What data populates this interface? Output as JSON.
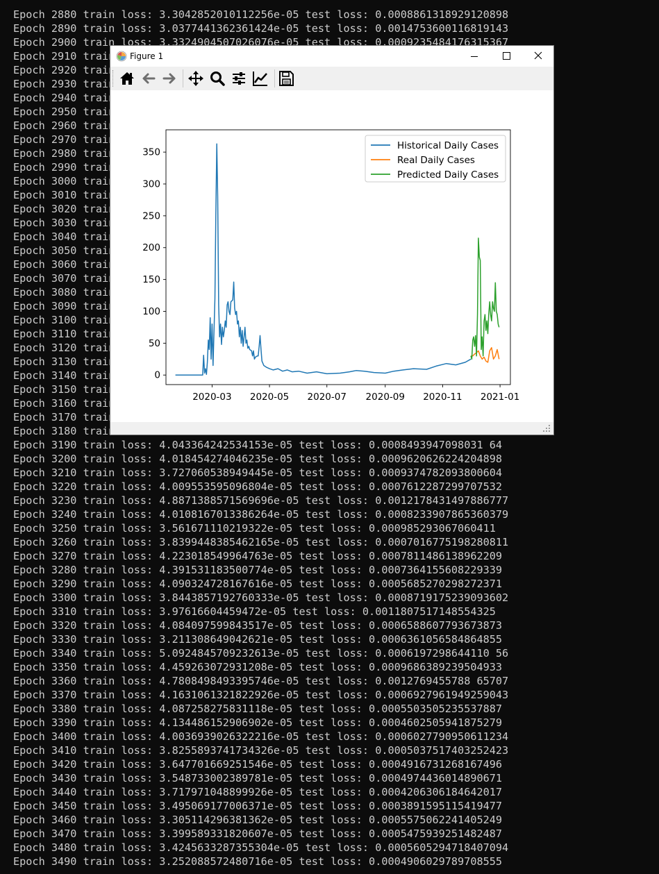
{
  "terminal": {
    "lines": [
      "Epoch 2880 train loss: 3.3042852010112256e-05 test loss: 0.0008861318929120898",
      "Epoch 2890 train loss: 3.0377441362361424e-05 test loss: 0.0014753600116819143",
      "Epoch 2900 train loss: 3.3324904507026076e-05 test loss: 0.0009235484176315367",
      "Epoch 2910 train",
      "Epoch 2920 train",
      "Epoch 2930 train",
      "Epoch 2940 train",
      "Epoch 2950 train",
      "Epoch 2960 train",
      "Epoch 2970 train",
      "Epoch 2980 train",
      "Epoch 2990 train",
      "Epoch 3000 train",
      "Epoch 3010 train",
      "Epoch 3020 train",
      "Epoch 3030 train",
      "Epoch 3040 train",
      "Epoch 3050 train",
      "Epoch 3060 train",
      "Epoch 3070 train",
      "Epoch 3080 train",
      "Epoch 3090 train",
      "Epoch 3100 train",
      "Epoch 3110 train",
      "Epoch 3120 train",
      "Epoch 3130 train",
      "Epoch 3140 train",
      "Epoch 3150 train",
      "Epoch 3160 train",
      "Epoch 3170 train",
      "Epoch 3180 train",
      "Epoch 3190 train loss: 4.043364242534153e-05 test loss: 0.0008493947098031 64",
      "Epoch 3200 train loss: 4.018454274046235e-05 test loss: 0.0009620626224204898",
      "Epoch 3210 train loss: 3.727060538949445e-05 test loss: 0.0009374782093800604",
      "Epoch 3220 train loss: 4.009553595096804e-05 test loss: 0.0007612287299707532",
      "Epoch 3230 train loss: 4.8871388571569696e-05 test loss: 0.0012178431497886777",
      "Epoch 3240 train loss: 4.0108167013386264e-05 test loss: 0.0008233907865360379",
      "Epoch 3250 train loss: 3.561671110219322e-05 test loss: 0.000985293067060411",
      "Epoch 3260 train loss: 3.8399448385462165e-05 test loss: 0.0007016775198280811",
      "Epoch 3270 train loss: 4.223018549964763e-05 test loss: 0.0007811486138962209",
      "Epoch 3280 train loss: 4.391531183500774e-05 test loss: 0.0007364155608229339",
      "Epoch 3290 train loss: 4.090324728167616e-05 test loss: 0.0005685270298272371",
      "Epoch 3300 train loss: 3.8443857192760333e-05 test loss: 0.0008719175239093602",
      "Epoch 3310 train loss: 3.97616604459472e-05 test loss: 0.0011807517148554325",
      "Epoch 3320 train loss: 4.084097599843517e-05 test loss: 0.0006588607793673873",
      "Epoch 3330 train loss: 3.211308649042621e-05 test loss: 0.0006361056584864855",
      "Epoch 3340 train loss: 5.0924845709232613e-05 test loss: 0.0006197298644110 56",
      "Epoch 3350 train loss: 4.459263072931208e-05 test loss: 0.0009686389239504933",
      "Epoch 3360 train loss: 4.7808498493395746e-05 test loss: 0.0012769455788 65707",
      "Epoch 3370 train loss: 4.1631061321822926e-05 test loss: 0.0006927961949259043",
      "Epoch 3380 train loss: 4.087258275831118e-05 test loss: 0.0005503505235537887",
      "Epoch 3390 train loss: 4.134486152906902e-05 test loss: 0.0004602505941875279",
      "Epoch 3400 train loss: 4.0036939026322216e-05 test loss: 0.0006027790950611234",
      "Epoch 3410 train loss: 3.8255893741734326e-05 test loss: 0.0005037517403252423",
      "Epoch 3420 train loss: 3.647701669251546e-05 test loss: 0.0004916731268167496",
      "Epoch 3430 train loss: 3.548733002389781e-05 test loss: 0.0004974436014890671",
      "Epoch 3440 train loss: 3.717971048899926e-05 test loss: 0.0004206306184642017",
      "Epoch 3450 train loss: 3.495069177006371e-05 test loss: 0.0003891595115419477",
      "Epoch 3460 train loss: 3.305114296381362e-05 test loss: 0.0005575062241405249",
      "Epoch 3470 train loss: 3.399589331820607e-05 test loss: 0.0005475939251482487",
      "Epoch 3480 train loss: 3.4245633287355304e-05 test loss: 0.0005605294718407094",
      "Epoch 3490 train loss: 3.252088572480716e-05 test loss: 0.0004906029789708555"
    ],
    "colors": {
      "background": "#0c0c0c",
      "text": "#cccccc"
    }
  },
  "window": {
    "title": "Figure 1",
    "controls": [
      "minimize-icon",
      "maximize-icon",
      "close-icon"
    ]
  },
  "toolbar": {
    "buttons": [
      "home-icon",
      "back-arrow-icon",
      "forward-arrow-icon",
      "pan-icon",
      "zoom-icon",
      "configure-subplots-icon",
      "edit-axis-icon",
      "save-icon"
    ]
  },
  "chart_data": {
    "type": "line",
    "title": "",
    "xlabel": "",
    "ylabel": "",
    "xlim": [
      "2020-01-12",
      "2021-01-12"
    ],
    "ylim": [
      -15,
      385
    ],
    "xticks": [
      "2020-03",
      "2020-05",
      "2020-07",
      "2020-09",
      "2020-11",
      "2021-01"
    ],
    "yticks": [
      0,
      50,
      100,
      150,
      200,
      250,
      300,
      350
    ],
    "legend_position": "top-right",
    "grid": false,
    "series": [
      {
        "name": "Historical Daily Cases",
        "color": "#1f77b4",
        "points": [
          [
            "2020-01-22",
            0
          ],
          [
            "2020-02-15",
            0
          ],
          [
            "2020-02-20",
            0
          ],
          [
            "2020-02-21",
            31
          ],
          [
            "2020-02-22",
            3
          ],
          [
            "2020-02-23",
            10
          ],
          [
            "2020-02-24",
            1
          ],
          [
            "2020-02-25",
            20
          ],
          [
            "2020-02-26",
            55
          ],
          [
            "2020-02-27",
            40
          ],
          [
            "2020-02-28",
            90
          ],
          [
            "2020-02-29",
            25
          ],
          [
            "2020-03-01",
            80
          ],
          [
            "2020-03-02",
            15
          ],
          [
            "2020-03-04",
            120
          ],
          [
            "2020-03-05",
            250
          ],
          [
            "2020-03-06",
            363
          ],
          [
            "2020-03-07",
            280
          ],
          [
            "2020-03-08",
            110
          ],
          [
            "2020-03-09",
            60
          ],
          [
            "2020-03-10",
            80
          ],
          [
            "2020-03-11",
            48
          ],
          [
            "2020-03-12",
            75
          ],
          [
            "2020-03-13",
            60
          ],
          [
            "2020-03-14",
            70
          ],
          [
            "2020-03-15",
            85
          ],
          [
            "2020-03-16",
            75
          ],
          [
            "2020-03-17",
            110
          ],
          [
            "2020-03-18",
            115
          ],
          [
            "2020-03-19",
            100
          ],
          [
            "2020-03-20",
            95
          ],
          [
            "2020-03-21",
            115
          ],
          [
            "2020-03-23",
            118
          ],
          [
            "2020-03-24",
            146
          ],
          [
            "2020-03-25",
            105
          ],
          [
            "2020-03-26",
            95
          ],
          [
            "2020-03-27",
            100
          ],
          [
            "2020-03-28",
            80
          ],
          [
            "2020-03-29",
            85
          ],
          [
            "2020-03-30",
            60
          ],
          [
            "2020-03-31",
            75
          ],
          [
            "2020-04-01",
            50
          ],
          [
            "2020-04-02",
            70
          ],
          [
            "2020-04-03",
            45
          ],
          [
            "2020-04-04",
            60
          ],
          [
            "2020-04-05",
            75
          ],
          [
            "2020-04-06",
            50
          ],
          [
            "2020-04-07",
            55
          ],
          [
            "2020-04-08",
            42
          ],
          [
            "2020-04-09",
            45
          ],
          [
            "2020-04-10",
            40
          ],
          [
            "2020-04-12",
            38
          ],
          [
            "2020-04-13",
            30
          ],
          [
            "2020-04-14",
            38
          ],
          [
            "2020-04-15",
            25
          ],
          [
            "2020-04-16",
            28
          ],
          [
            "2020-04-18",
            30
          ],
          [
            "2020-04-19",
            30
          ],
          [
            "2020-04-20",
            45
          ],
          [
            "2020-04-21",
            62
          ],
          [
            "2020-04-22",
            40
          ],
          [
            "2020-04-23",
            22
          ],
          [
            "2020-04-25",
            15
          ],
          [
            "2020-04-28",
            12
          ],
          [
            "2020-05-01",
            10
          ],
          [
            "2020-05-05",
            8
          ],
          [
            "2020-05-10",
            10
          ],
          [
            "2020-05-15",
            6
          ],
          [
            "2020-05-20",
            8
          ],
          [
            "2020-05-25",
            5
          ],
          [
            "2020-06-01",
            6
          ],
          [
            "2020-06-10",
            3
          ],
          [
            "2020-06-20",
            5
          ],
          [
            "2020-07-01",
            2
          ],
          [
            "2020-07-15",
            3
          ],
          [
            "2020-07-25",
            5
          ],
          [
            "2020-08-01",
            7
          ],
          [
            "2020-08-10",
            6
          ],
          [
            "2020-08-20",
            4
          ],
          [
            "2020-09-01",
            3
          ],
          [
            "2020-09-10",
            6
          ],
          [
            "2020-09-20",
            8
          ],
          [
            "2020-10-01",
            10
          ],
          [
            "2020-10-15",
            9
          ],
          [
            "2020-10-25",
            14
          ],
          [
            "2020-11-05",
            18
          ],
          [
            "2020-11-15",
            16
          ],
          [
            "2020-11-25",
            20
          ],
          [
            "2020-12-01",
            25
          ]
        ]
      },
      {
        "name": "Real Daily Cases",
        "color": "#ff7f0e",
        "points": [
          [
            "2020-12-01",
            30
          ],
          [
            "2020-12-03",
            30
          ],
          [
            "2020-12-05",
            33
          ],
          [
            "2020-12-07",
            35
          ],
          [
            "2020-12-09",
            38
          ],
          [
            "2020-12-11",
            30
          ],
          [
            "2020-12-13",
            25
          ],
          [
            "2020-12-15",
            28
          ],
          [
            "2020-12-17",
            22
          ],
          [
            "2020-12-19",
            20
          ],
          [
            "2020-12-21",
            38
          ],
          [
            "2020-12-23",
            43
          ],
          [
            "2020-12-25",
            25
          ],
          [
            "2020-12-27",
            30
          ],
          [
            "2020-12-29",
            40
          ],
          [
            "2020-12-31",
            25
          ]
        ]
      },
      {
        "name": "Predicted Daily Cases",
        "color": "#2ca02c",
        "points": [
          [
            "2020-12-01",
            30
          ],
          [
            "2020-12-02",
            25
          ],
          [
            "2020-12-03",
            55
          ],
          [
            "2020-12-04",
            60
          ],
          [
            "2020-12-05",
            45
          ],
          [
            "2020-12-06",
            62
          ],
          [
            "2020-12-07",
            30
          ],
          [
            "2020-12-08",
            95
          ],
          [
            "2020-12-09",
            215
          ],
          [
            "2020-12-10",
            185
          ],
          [
            "2020-12-11",
            180
          ],
          [
            "2020-12-12",
            40
          ],
          [
            "2020-12-13",
            60
          ],
          [
            "2020-12-14",
            30
          ],
          [
            "2020-12-15",
            85
          ],
          [
            "2020-12-16",
            95
          ],
          [
            "2020-12-17",
            70
          ],
          [
            "2020-12-18",
            85
          ],
          [
            "2020-12-19",
            65
          ],
          [
            "2020-12-20",
            95
          ],
          [
            "2020-12-21",
            115
          ],
          [
            "2020-12-22",
            95
          ],
          [
            "2020-12-23",
            85
          ],
          [
            "2020-12-24",
            115
          ],
          [
            "2020-12-25",
            105
          ],
          [
            "2020-12-26",
            100
          ],
          [
            "2020-12-27",
            145
          ],
          [
            "2020-12-28",
            100
          ],
          [
            "2020-12-29",
            95
          ],
          [
            "2020-12-30",
            80
          ],
          [
            "2020-12-31",
            75
          ]
        ]
      }
    ]
  }
}
